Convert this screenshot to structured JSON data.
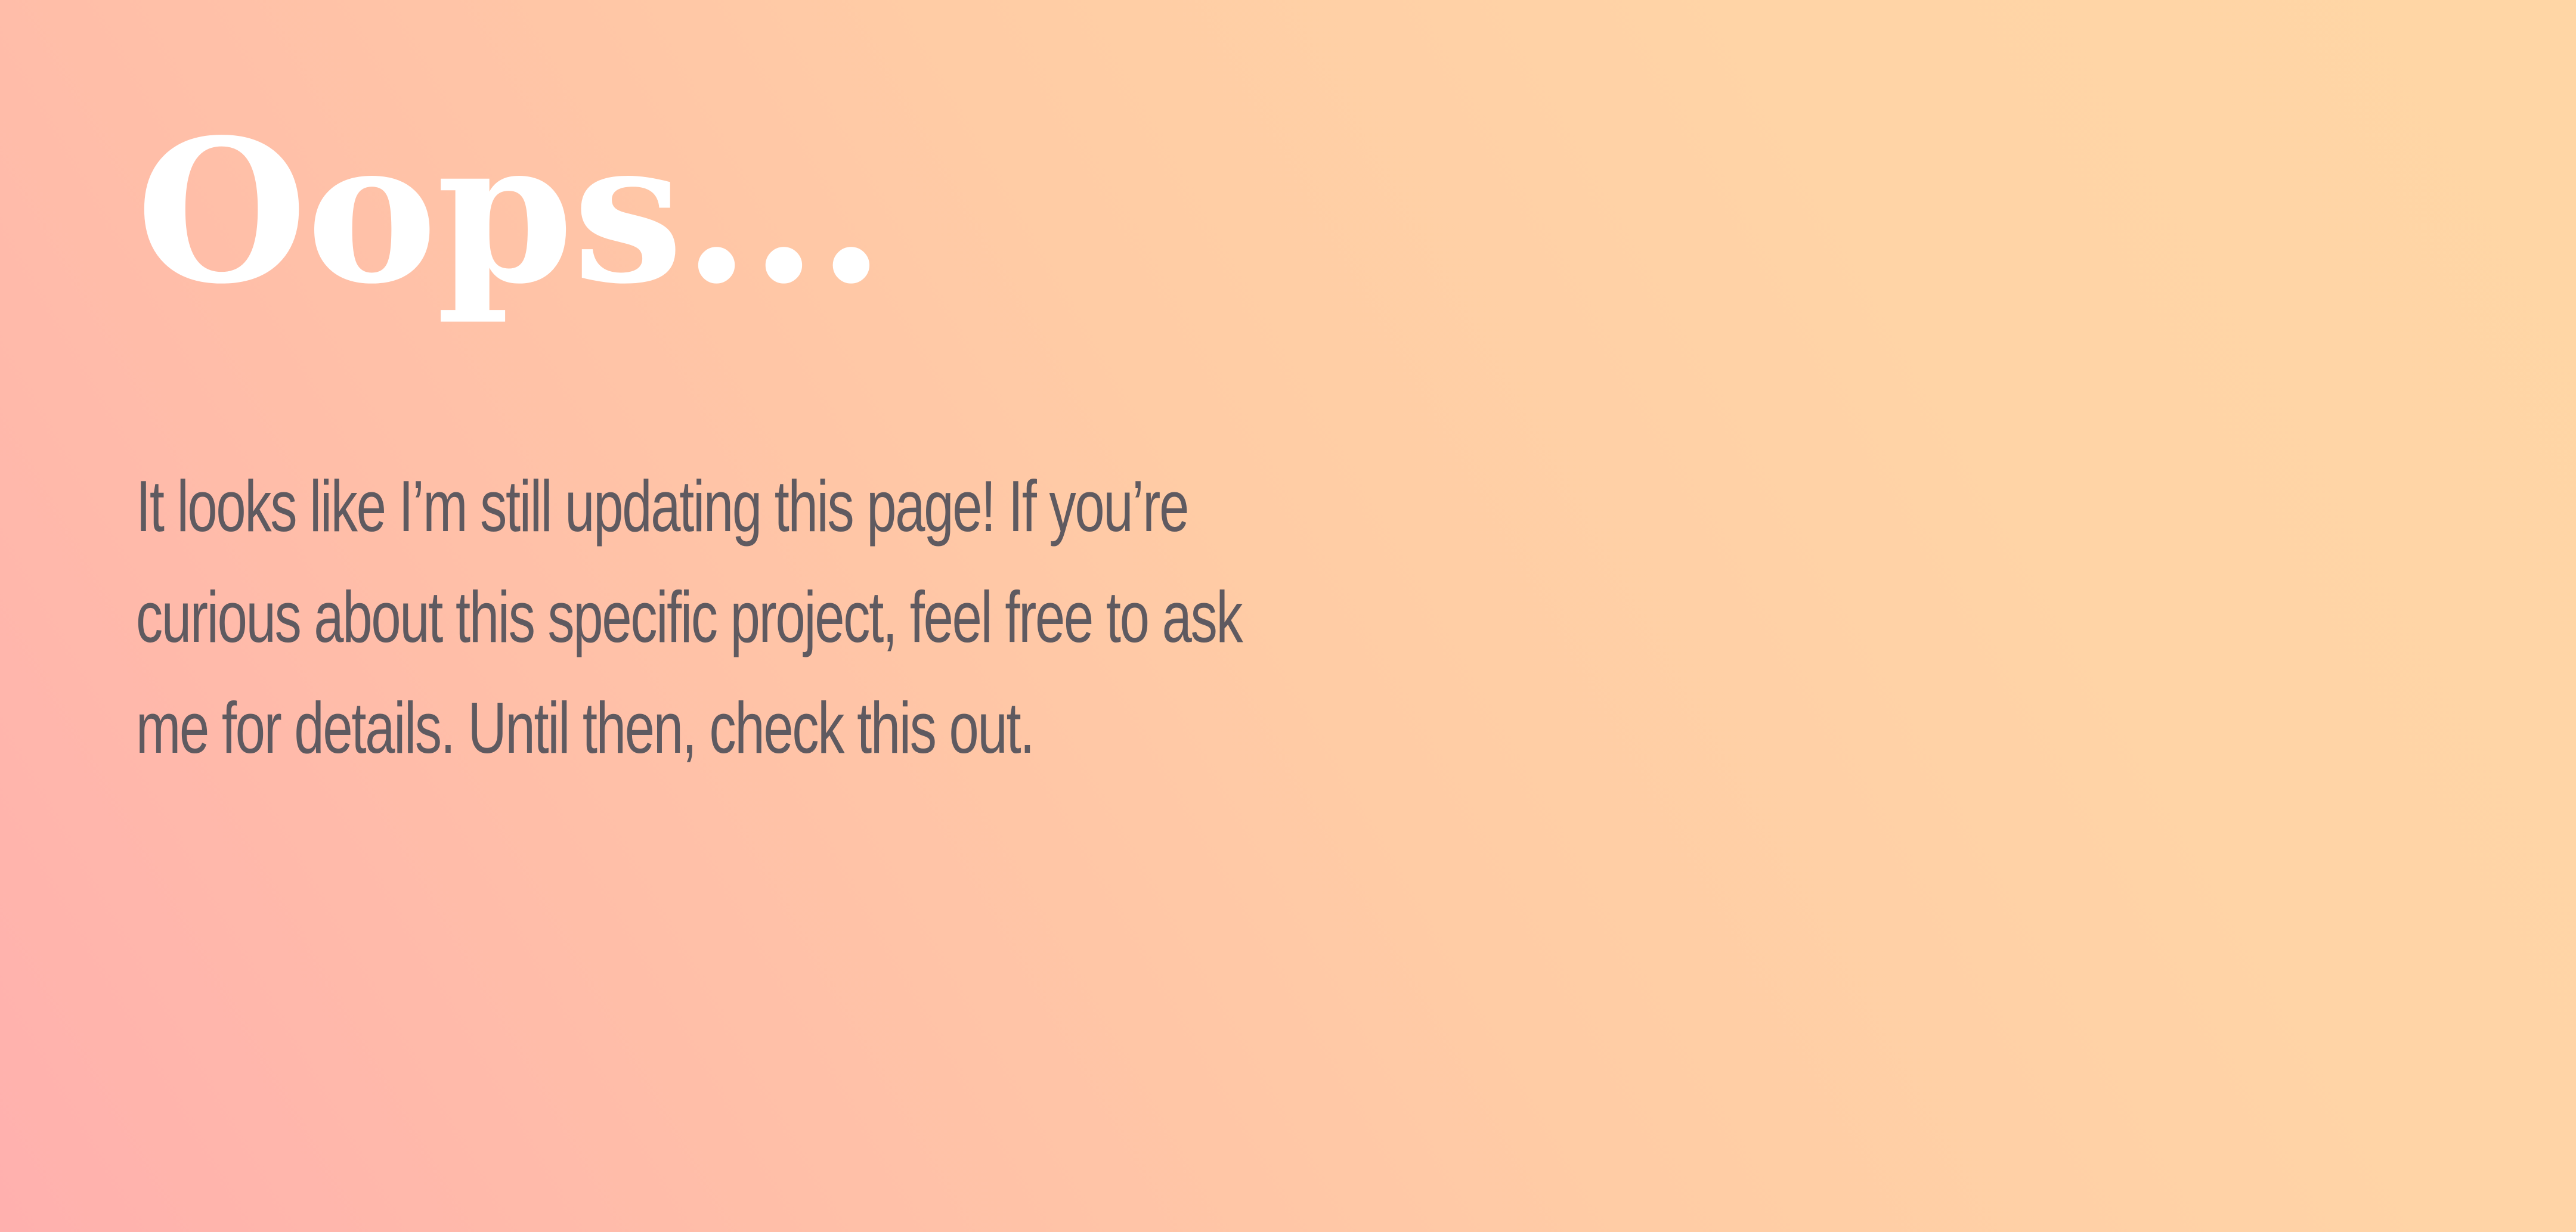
{
  "page": {
    "background_colors": [
      "#ffb0ae",
      "#ffd6a5"
    ],
    "title": "Oops...",
    "message_lines": [
      "It looks like I’m still updating this page! If you’re",
      "curious about this specific project, feel free to ask",
      "me for details. Until then, check this out."
    ],
    "title_color": "#ffffff",
    "text_color": "#5f5a60"
  }
}
